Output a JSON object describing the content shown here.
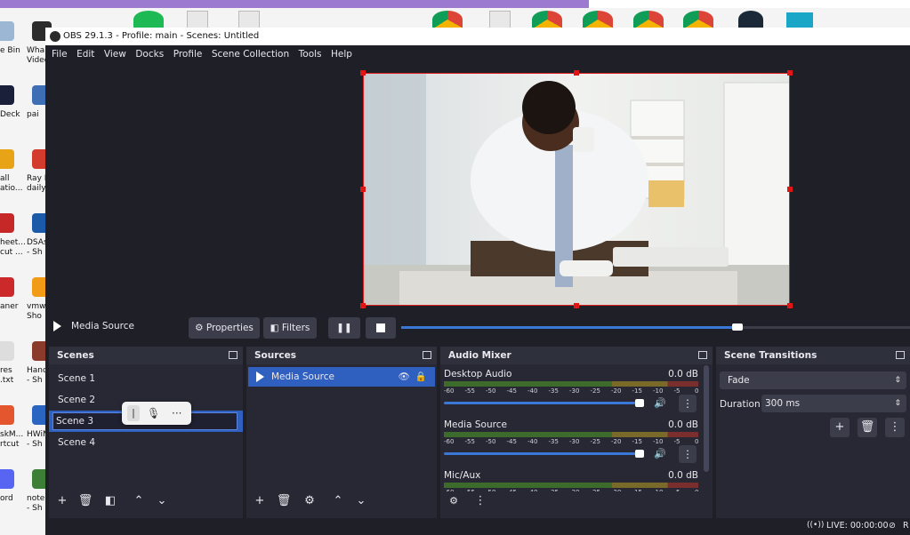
{
  "window": {
    "title": "OBS 29.1.3 - Profile: main - Scenes: Untitled"
  },
  "menu": [
    "File",
    "Edit",
    "View",
    "Docks",
    "Profile",
    "Scene Collection",
    "Tools",
    "Help"
  ],
  "desktop_icons": [
    {
      "label": "e Bin",
      "color": "#9bb7d4"
    },
    {
      "label": "Wha\nVideo",
      "color": "#2c2c2c"
    },
    {
      "label": "Deck",
      "color": "#1a1f3a"
    },
    {
      "label": "pai",
      "color": "#3e6fb5"
    },
    {
      "label": "all\natio...",
      "color": "#e8a317"
    },
    {
      "label": "Ray E\ndaily h",
      "color": "#d33b2c"
    },
    {
      "label": "heet...\ncut ...",
      "color": "#c62828"
    },
    {
      "label": "DSAss\n- Sh",
      "color": "#1b5aa8"
    },
    {
      "label": "aner",
      "color": "#cc2a2a"
    },
    {
      "label": "vmwa\nSho",
      "color": "#f29b16"
    },
    {
      "label": "res\n.txt",
      "color": "#dddddd"
    },
    {
      "label": "Handl\n- Sh",
      "color": "#8a3b2a"
    },
    {
      "label": "skM...\nrtcut",
      "color": "#e4572e"
    },
    {
      "label": "HWiN\n- Sh",
      "color": "#2b65c2"
    },
    {
      "label": "ord",
      "color": "#5865f2"
    },
    {
      "label": "notep\n- Sh",
      "color": "#3d7f36"
    }
  ],
  "media_controls": {
    "source_name": "Media Source",
    "properties_label": "Properties",
    "filters_label": "Filters",
    "seek_progress": 0.66
  },
  "scenes": {
    "title": "Scenes",
    "items": [
      "Scene 1",
      "Scene 2",
      "Scene 3",
      "Scene 4"
    ],
    "selected_index": 2,
    "editing_value": "Scene 3"
  },
  "sources": {
    "title": "Sources",
    "items": [
      {
        "label": "Media Source"
      }
    ]
  },
  "audio_mixer": {
    "title": "Audio Mixer",
    "scale": [
      "-60",
      "-55",
      "-50",
      "-45",
      "-40",
      "-35",
      "-30",
      "-25",
      "-20",
      "-15",
      "-10",
      "-5",
      "0"
    ],
    "channels": [
      {
        "name": "Desktop Audio",
        "level": "0.0 dB",
        "volume": 0.98
      },
      {
        "name": "Media Source",
        "level": "0.0 dB",
        "volume": 0.98
      },
      {
        "name": "Mic/Aux",
        "level": "0.0 dB",
        "volume": 0.98
      }
    ]
  },
  "transitions": {
    "title": "Scene Transitions",
    "selected": "Fade",
    "duration_label": "Duration",
    "duration_value": "300 ms"
  },
  "status": {
    "live": "LIVE: 00:00:00",
    "rec": "R"
  },
  "colors": {
    "accent": "#3b77d6",
    "selection": "#2f5fbf",
    "red": "#e01515"
  }
}
